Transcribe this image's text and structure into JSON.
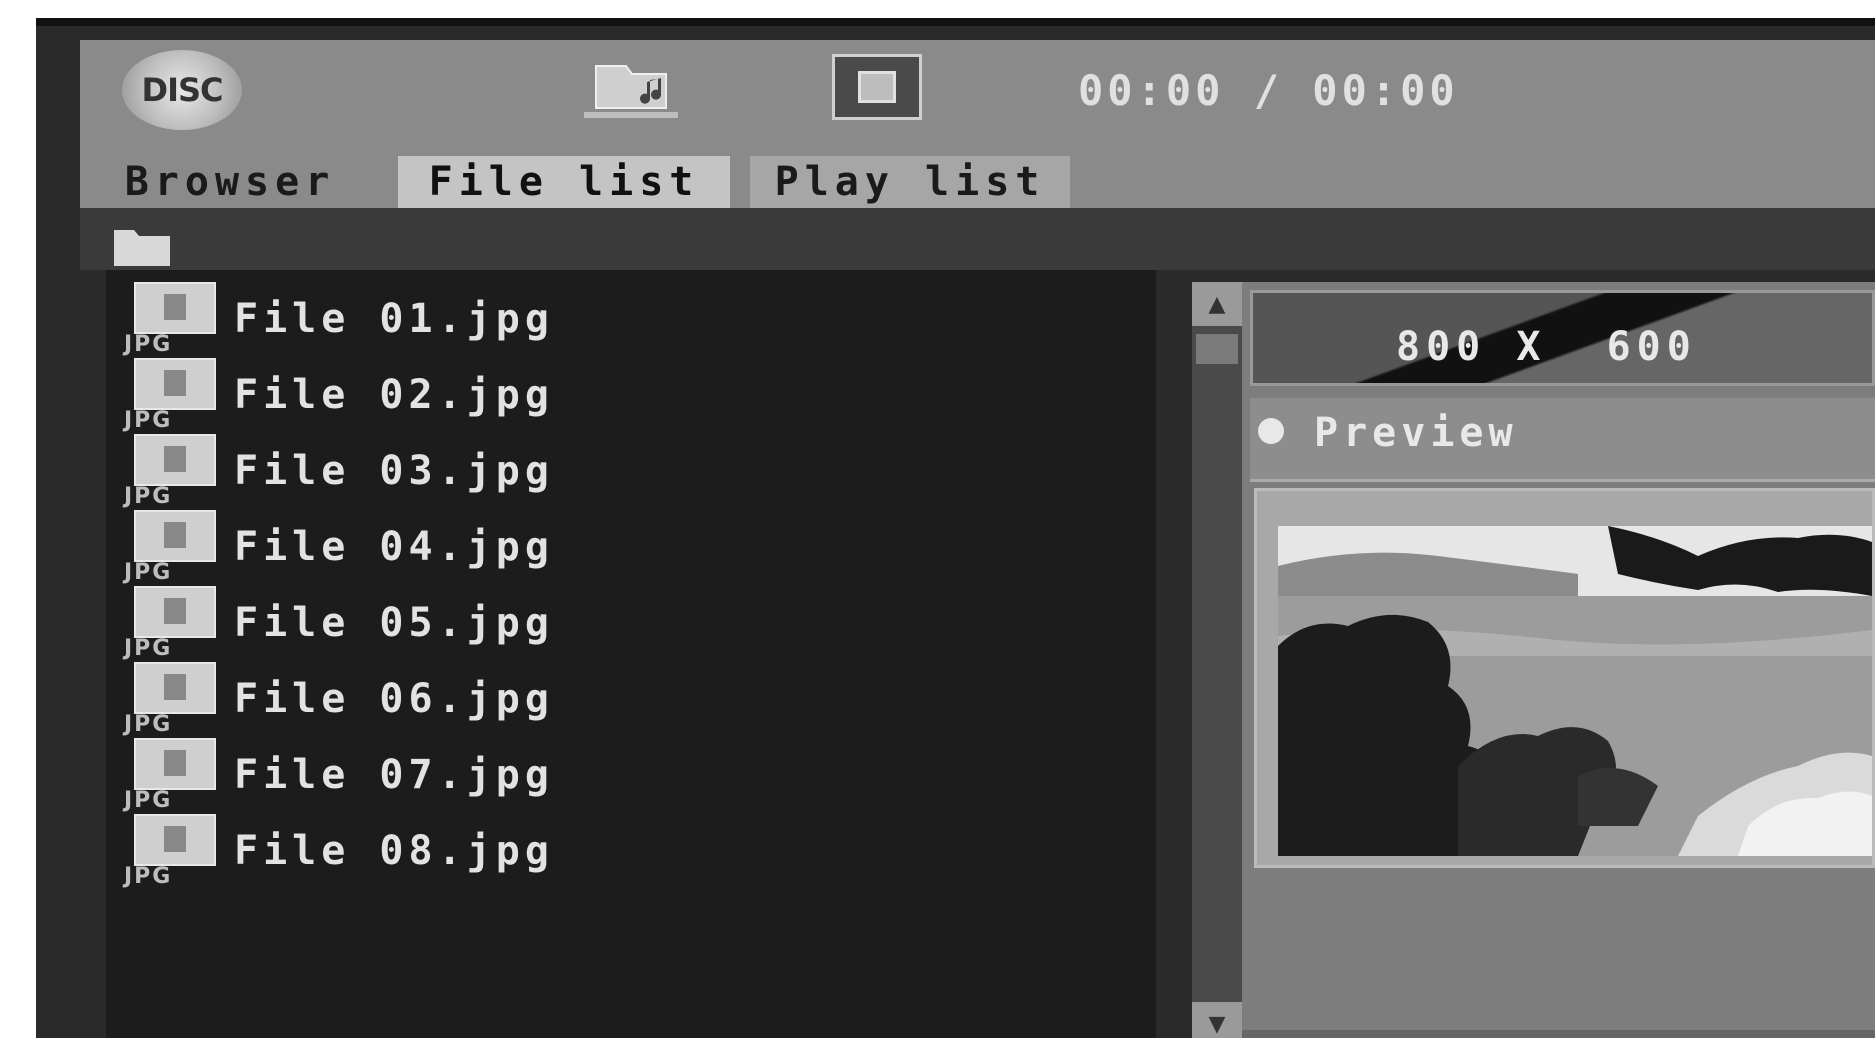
{
  "header": {
    "disc_label": "DISC",
    "time_readout": "00:00 / 00:00"
  },
  "tabs": [
    {
      "label": "Browser",
      "selected": false
    },
    {
      "label": "File list",
      "selected": true
    },
    {
      "label": "Play list",
      "selected": false
    }
  ],
  "files": [
    {
      "name": "File 01.jpg",
      "type_label": "JPG"
    },
    {
      "name": "File 02.jpg",
      "type_label": "JPG"
    },
    {
      "name": "File 03.jpg",
      "type_label": "JPG"
    },
    {
      "name": "File 04.jpg",
      "type_label": "JPG"
    },
    {
      "name": "File 05.jpg",
      "type_label": "JPG"
    },
    {
      "name": "File 06.jpg",
      "type_label": "JPG"
    },
    {
      "name": "File 07.jpg",
      "type_label": "JPG"
    },
    {
      "name": "File 08.jpg",
      "type_label": "JPG"
    }
  ],
  "info": {
    "resolution": "800 X  600",
    "preview_label": "Preview"
  },
  "icons": {
    "disc": "disc-icon",
    "music_folder": "music-folder-icon",
    "stop": "stop-icon",
    "path_folder": "folder-icon",
    "file": "jpg-file-icon",
    "scroll_up": "scroll-up-arrow-icon",
    "scroll_down": "scroll-down-arrow-icon"
  }
}
